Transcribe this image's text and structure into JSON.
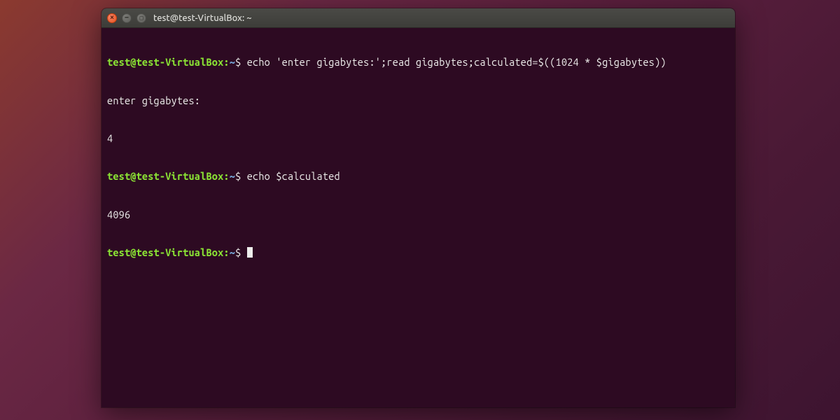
{
  "window": {
    "title": "test@test-VirtualBox: ~"
  },
  "prompt": {
    "user_host": "test@test-VirtualBox",
    "separator": ":",
    "path": "~",
    "symbol": "$"
  },
  "lines": {
    "cmd1": "echo 'enter gigabytes:';read gigabytes;calculated=$((1024 * $gigabytes))",
    "out1": "enter gigabytes:",
    "out2": "4",
    "cmd2": "echo $calculated",
    "out3": "4096"
  },
  "colors": {
    "background": "#2d0a22",
    "prompt_user": "#8ae234",
    "prompt_path": "#729fcf",
    "text": "#eeeeec",
    "titlebar": "#3d3d39",
    "close_btn": "#e95420"
  }
}
